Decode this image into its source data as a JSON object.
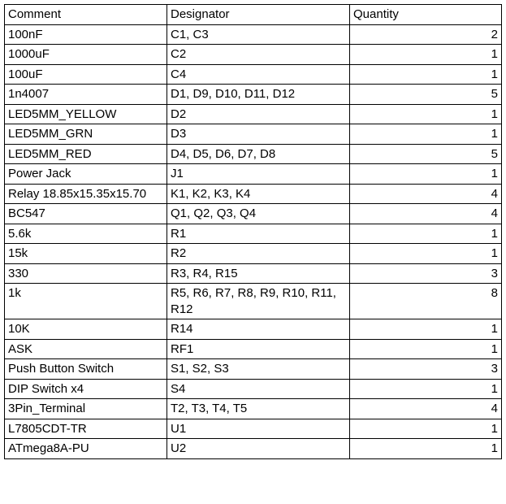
{
  "table": {
    "headers": {
      "comment": "Comment",
      "designator": "Designator",
      "quantity": "Quantity"
    },
    "rows": [
      {
        "comment": "100nF",
        "designator": "C1, C3",
        "quantity": "2"
      },
      {
        "comment": "1000uF",
        "designator": "C2",
        "quantity": "1"
      },
      {
        "comment": "100uF",
        "designator": "C4",
        "quantity": "1"
      },
      {
        "comment": "1n4007",
        "designator": "D1, D9, D10, D11, D12",
        "quantity": "5"
      },
      {
        "comment": "LED5MM_YELLOW",
        "designator": "D2",
        "quantity": "1"
      },
      {
        "comment": "LED5MM_GRN",
        "designator": "D3",
        "quantity": "1"
      },
      {
        "comment": "LED5MM_RED",
        "designator": "D4, D5, D6, D7, D8",
        "quantity": "5"
      },
      {
        "comment": "Power Jack",
        "designator": "J1",
        "quantity": "1"
      },
      {
        "comment": "Relay 18.85x15.35x15.70",
        "designator": "K1, K2, K3, K4",
        "quantity": "4"
      },
      {
        "comment": "BC547",
        "designator": "Q1, Q2, Q3, Q4",
        "quantity": "4"
      },
      {
        "comment": "5.6k",
        "designator": "R1",
        "quantity": "1"
      },
      {
        "comment": "15k",
        "designator": "R2",
        "quantity": "1"
      },
      {
        "comment": "330",
        "designator": "R3, R4, R15",
        "quantity": "3"
      },
      {
        "comment": "1k",
        "designator": "R5, R6, R7, R8, R9, R10, R11, R12",
        "quantity": "8"
      },
      {
        "comment": "10K",
        "designator": "R14",
        "quantity": "1"
      },
      {
        "comment": "ASK",
        "designator": "RF1",
        "quantity": "1"
      },
      {
        "comment": "Push Button Switch",
        "designator": "S1, S2, S3",
        "quantity": "3"
      },
      {
        "comment": "DIP Switch x4",
        "designator": "S4",
        "quantity": "1"
      },
      {
        "comment": "3Pin_Terminal",
        "designator": "T2, T3, T4, T5",
        "quantity": "4"
      },
      {
        "comment": "L7805CDT-TR",
        "designator": "U1",
        "quantity": "1"
      },
      {
        "comment": "ATmega8A-PU",
        "designator": "U2",
        "quantity": "1"
      }
    ]
  },
  "chart_data": {
    "type": "table",
    "columns": [
      "Comment",
      "Designator",
      "Quantity"
    ],
    "rows": [
      [
        "100nF",
        "C1, C3",
        2
      ],
      [
        "1000uF",
        "C2",
        1
      ],
      [
        "100uF",
        "C4",
        1
      ],
      [
        "1n4007",
        "D1, D9, D10, D11, D12",
        5
      ],
      [
        "LED5MM_YELLOW",
        "D2",
        1
      ],
      [
        "LED5MM_GRN",
        "D3",
        1
      ],
      [
        "LED5MM_RED",
        "D4, D5, D6, D7, D8",
        5
      ],
      [
        "Power Jack",
        "J1",
        1
      ],
      [
        "Relay 18.85x15.35x15.70",
        "K1, K2, K3, K4",
        4
      ],
      [
        "BC547",
        "Q1, Q2, Q3, Q4",
        4
      ],
      [
        "5.6k",
        "R1",
        1
      ],
      [
        "15k",
        "R2",
        1
      ],
      [
        "330",
        "R3, R4, R15",
        3
      ],
      [
        "1k",
        "R5, R6, R7, R8, R9, R10, R11, R12",
        8
      ],
      [
        "10K",
        "R14",
        1
      ],
      [
        "ASK",
        "RF1",
        1
      ],
      [
        "Push Button Switch",
        "S1, S2, S3",
        3
      ],
      [
        "DIP Switch x4",
        "S4",
        1
      ],
      [
        "3Pin_Terminal",
        "T2, T3, T4, T5",
        4
      ],
      [
        "L7805CDT-TR",
        "U1",
        1
      ],
      [
        "ATmega8A-PU",
        "U2",
        1
      ]
    ]
  }
}
